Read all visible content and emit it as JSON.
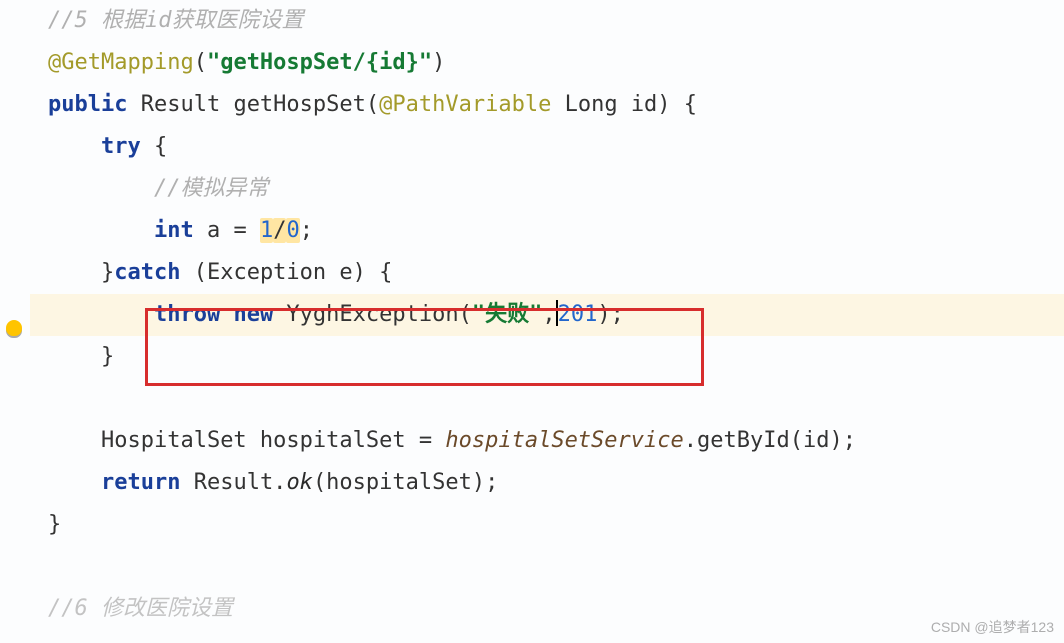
{
  "code": {
    "l1_comment": "//5 根据id获取医院设置",
    "l2_anno": "@GetMapping",
    "l2_paren_open": "(",
    "l2_string": "\"getHospSet/{id}\"",
    "l2_paren_close": ")",
    "l3_kw_public": "public",
    "l3_type": " Result getHospSet(",
    "l3_anno": "@PathVariable",
    "l3_rest": " Long id) {",
    "l4_kw_try": "try",
    "l4_rest": " {",
    "l5_comment": "//模拟异常",
    "l6_kw_int": "int",
    "l6_mid": " a = ",
    "l6_num1": "1",
    "l6_slash": "/",
    "l6_num2": "0",
    "l6_semi": ";",
    "l7_close": "}",
    "l7_kw_catch": "catch",
    "l7_rest": " (Exception e) {",
    "l8_kw_throw": "throw",
    "l8_kw_new": " new",
    "l8_class": " YyghException(",
    "l8_string": "\"失败\"",
    "l8_comma": ",",
    "l8_num": "201",
    "l8_end": ");",
    "l9_close": "}",
    "l11_a": "HospitalSet hospitalSet = ",
    "l11_svc": "hospitalSetService",
    "l11_b": ".getById(id);",
    "l12_kw_return": "return",
    "l12_a": " Result.",
    "l12_ok": "ok",
    "l12_b": "(hospitalSet);",
    "l13_close": "}",
    "l15_comment": "//6 修改医院设置"
  },
  "watermark": "CSDN @追梦者123"
}
